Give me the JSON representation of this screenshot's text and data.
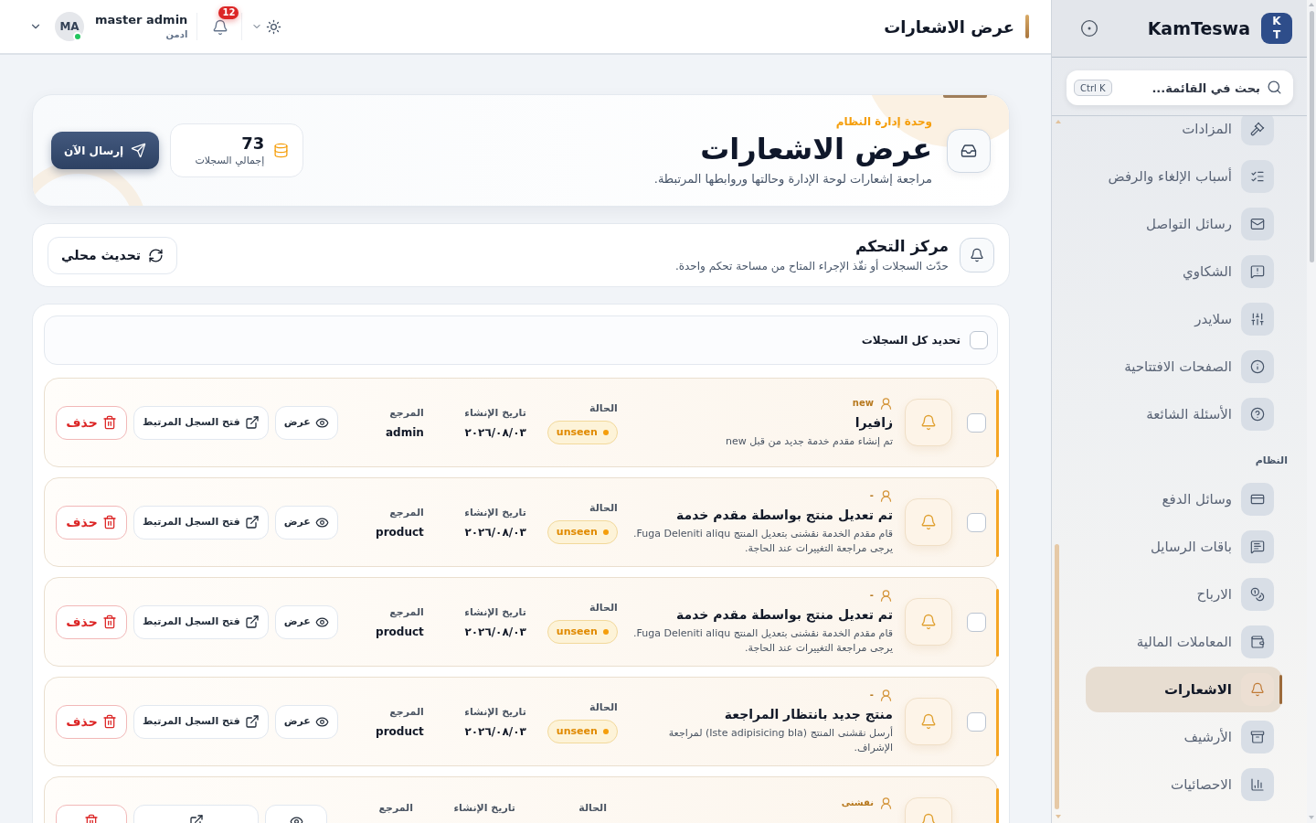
{
  "topbar": {
    "title": "عرض الاشعارات",
    "notifications": {
      "count": "12"
    },
    "user": {
      "name": "master admin",
      "role": "ادمن",
      "initials": "MA",
      "online": true
    }
  },
  "hero": {
    "eyebrow": "وحدة إدارة النظام",
    "title": "عرض الاشعارات",
    "description": "مراجعة إشعارات لوحة الإدارة وحالتها وروابطها المرتبطة.",
    "stat": {
      "value": "73",
      "label": "إجمالي السجلات"
    },
    "button": "إرسال الآن"
  },
  "control_center": {
    "title": "مركز التحكم",
    "description": "حدّث السجلات أو نفّذ الإجراء المتاح من مساحة تحكم واحدة.",
    "button": "تحديث محلي"
  },
  "records": {
    "select_all": {
      "label": "تحديد كل السجلات",
      "checked": false
    },
    "rows": [
      {
        "checked": false,
        "tag": "new",
        "title": "زافيرا",
        "description": "تم إنشاء مقدم خدمة جديد من قبل new",
        "fields": [
          {
            "kind": "status",
            "label": "الحالة",
            "value": "unseen"
          },
          {
            "kind": "text",
            "label": "تاريخ الإنشاء",
            "value": "٢٠٢٦/٠٨/٠٣"
          },
          {
            "kind": "text",
            "label": "المرجع",
            "value": "admin"
          }
        ],
        "actions": [
          {
            "kind": "view",
            "label": "عرض"
          },
          {
            "kind": "open",
            "label": "فتح السجل المرتبط"
          },
          {
            "kind": "delete",
            "label": "حذف"
          }
        ]
      },
      {
        "checked": false,
        "tag": "-",
        "title": "تم تعديل منتج بواسطة مقدم خدمة",
        "description": "قام مقدم الخدمة نقشنى بتعديل المنتج Fuga Deleniti aliqu. يرجى مراجعة التغييرات عند الحاجة.",
        "fields": [
          {
            "kind": "status",
            "label": "الحالة",
            "value": "unseen"
          },
          {
            "kind": "text",
            "label": "تاريخ الإنشاء",
            "value": "٢٠٢٦/٠٨/٠٣"
          },
          {
            "kind": "text",
            "label": "المرجع",
            "value": "product"
          }
        ],
        "actions": [
          {
            "kind": "view",
            "label": "عرض"
          },
          {
            "kind": "open",
            "label": "فتح السجل المرتبط"
          },
          {
            "kind": "delete",
            "label": "حذف"
          }
        ]
      },
      {
        "checked": false,
        "tag": "-",
        "title": "تم تعديل منتج بواسطة مقدم خدمة",
        "description": "قام مقدم الخدمة نقشنى بتعديل المنتج Fuga Deleniti aliqu. يرجى مراجعة التغييرات عند الحاجة.",
        "fields": [
          {
            "kind": "status",
            "label": "الحالة",
            "value": "unseen"
          },
          {
            "kind": "text",
            "label": "تاريخ الإنشاء",
            "value": "٢٠٢٦/٠٨/٠٣"
          },
          {
            "kind": "text",
            "label": "المرجع",
            "value": "product"
          }
        ],
        "actions": [
          {
            "kind": "view",
            "label": "عرض"
          },
          {
            "kind": "open",
            "label": "فتح السجل المرتبط"
          },
          {
            "kind": "delete",
            "label": "حذف"
          }
        ]
      },
      {
        "checked": false,
        "tag": "-",
        "title": "منتج جديد بانتظار المراجعة",
        "description": "أرسل نقشنى المنتج (Iste adipisicing bla) لمراجعة الإشراف.",
        "fields": [
          {
            "kind": "status",
            "label": "الحالة",
            "value": "unseen"
          },
          {
            "kind": "text",
            "label": "تاريخ الإنشاء",
            "value": "٢٠٢٦/٠٨/٠٣"
          },
          {
            "kind": "text",
            "label": "المرجع",
            "value": "product"
          }
        ],
        "actions": [
          {
            "kind": "view",
            "label": "عرض"
          },
          {
            "kind": "open",
            "label": "فتح السجل المرتبط"
          },
          {
            "kind": "delete",
            "label": "حذف"
          }
        ]
      },
      {
        "tag": "نقشنى",
        "fields": [
          {
            "label": "الحالة"
          },
          {
            "label": "تاريخ الإنشاء"
          },
          {
            "label": "المرجع"
          }
        ],
        "actions": [
          {
            "kind": "view"
          },
          {
            "kind": "open"
          },
          {
            "kind": "delete"
          }
        ]
      }
    ]
  },
  "sidebar": {
    "logo": "KT",
    "brand": "KamTeswa",
    "search": {
      "placeholder": "بحث في القائمة...",
      "shortcut": "Ctrl K"
    },
    "sections": [
      {
        "items": [
          {
            "label": "المزادات",
            "selected": false
          },
          {
            "label": "أسباب الإلغاء والرفض",
            "selected": false
          },
          {
            "label": "رسائل التواصل",
            "selected": false
          },
          {
            "label": "الشكاوي",
            "selected": false
          },
          {
            "label": "سلايدر",
            "selected": false
          },
          {
            "label": "الصفحات الافتتاحية",
            "selected": false
          },
          {
            "label": "الأسئلة الشائعة",
            "selected": false
          }
        ]
      },
      {
        "title": "النظام",
        "items": [
          {
            "label": "وسائل الدفع",
            "selected": false
          },
          {
            "label": "باقات الرسايل",
            "selected": false
          },
          {
            "label": "الارباح",
            "selected": false
          },
          {
            "label": "المعاملات المالية",
            "selected": false
          },
          {
            "label": "الاشعارات",
            "selected": true
          },
          {
            "label": "الأرشيف",
            "selected": false
          },
          {
            "label": "الاحصائيات",
            "selected": false
          }
        ]
      }
    ]
  }
}
